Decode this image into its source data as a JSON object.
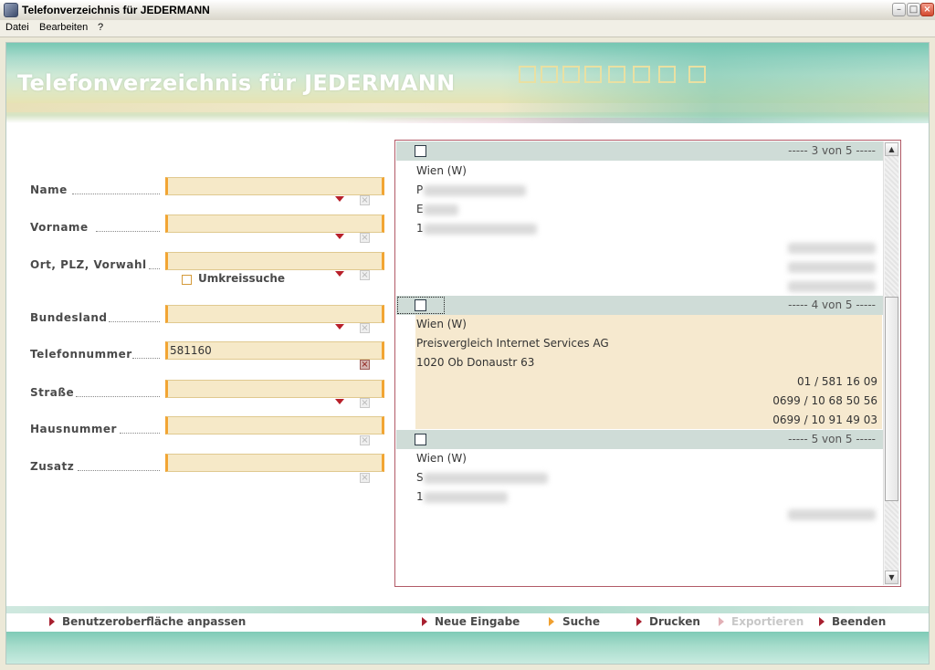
{
  "window": {
    "title": "Telefonverzeichnis für JEDERMANN",
    "min": "–",
    "max": "□",
    "close": "×"
  },
  "menu": [
    "Datei",
    "Bearbeiten",
    "?"
  ],
  "banner": {
    "title": "Telefonverzeichnis für JEDERMANN"
  },
  "form": {
    "fields": [
      {
        "label": "Name",
        "value": "",
        "has_dropdown": true
      },
      {
        "label": "Vorname",
        "value": "",
        "has_dropdown": true
      },
      {
        "label": "Ort, PLZ, Vorwahl",
        "value": "",
        "has_dropdown": true
      },
      {
        "label": "Bundesland",
        "value": "",
        "has_dropdown": true
      },
      {
        "label": "Telefonnummer",
        "value": "581160",
        "has_dropdown": false
      },
      {
        "label": "Straße",
        "value": "",
        "has_dropdown": true
      },
      {
        "label": "Hausnummer",
        "value": "",
        "has_dropdown": false
      },
      {
        "label": "Zusatz",
        "value": "",
        "has_dropdown": false
      }
    ],
    "umkreissuche": {
      "label": "Umkreissuche",
      "checked": false
    },
    "clear_glyph": "×"
  },
  "results": {
    "entries": [
      {
        "counter": "----- 3 von 5 -----",
        "region": "Wien (W)",
        "line1": "P",
        "line2": "E",
        "line3": "1",
        "checked": false
      },
      {
        "counter": "----- 4 von 5 -----",
        "region": "Wien (W)",
        "line1": "Preisvergleich Internet Services AG",
        "line2": "1020 Ob Donaustr 63",
        "phones": [
          "01 / 581 16 09",
          "0699 / 10 68 50 56",
          "0699 / 10 91 49 03"
        ],
        "checked": false,
        "selected": true
      },
      {
        "counter": "----- 5 von 5 -----",
        "region": "Wien (W)",
        "line1": "S",
        "line2": "1",
        "checked": false
      }
    ],
    "scroll_up": "▲",
    "scroll_down": "▼"
  },
  "bottom_nav": {
    "customize": "Benutzeroberfläche anpassen",
    "new_entry": "Neue Eingabe",
    "search": "Suche",
    "print": "Drucken",
    "export": "Exportieren",
    "exit": "Beenden"
  }
}
